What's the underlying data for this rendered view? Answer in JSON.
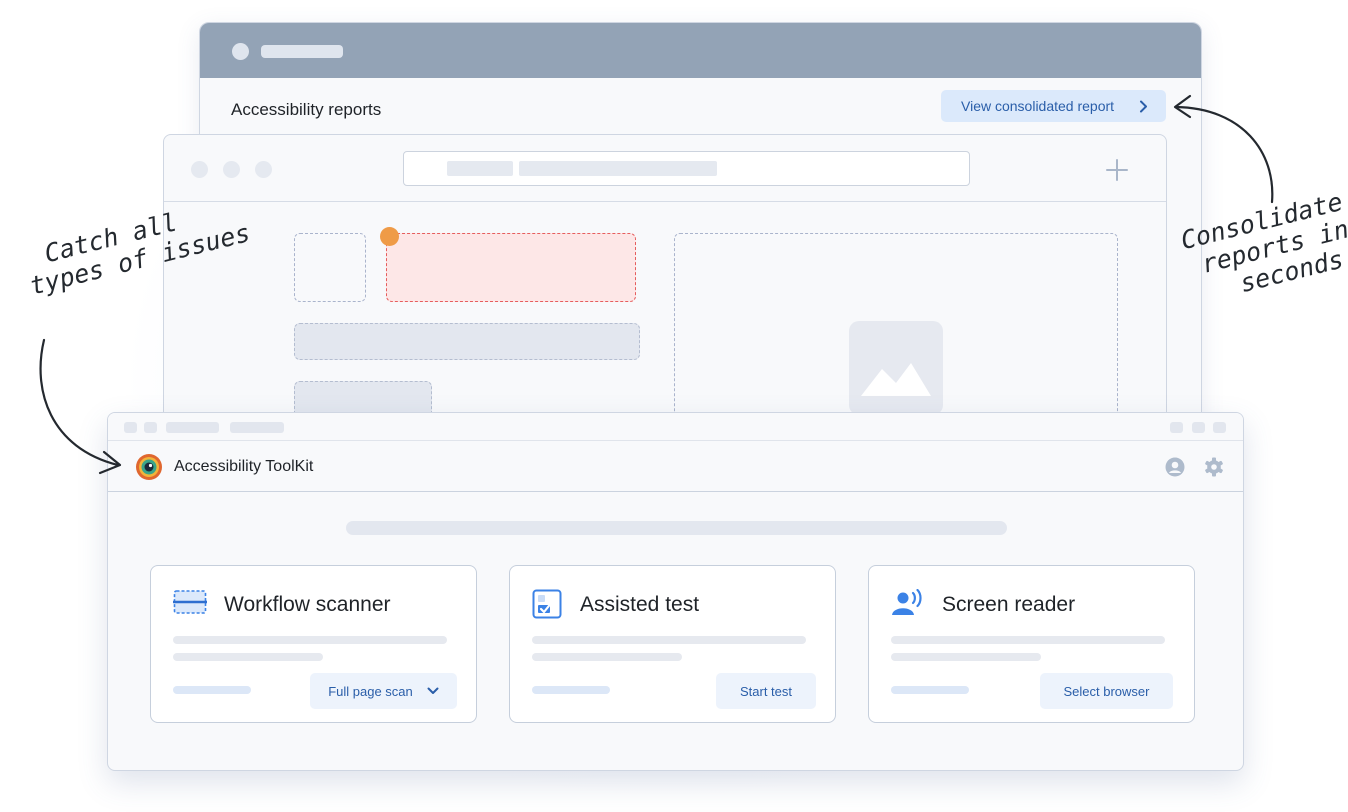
{
  "back_window": {
    "title": "Accessibility reports",
    "consolidated_button": "View consolidated report"
  },
  "toolkit": {
    "app_title": "Accessibility ToolKit",
    "icons": [
      "account-icon",
      "settings-gear-icon"
    ],
    "cards": [
      {
        "title": "Workflow scanner",
        "icon": "scanner-icon",
        "button": "Full page scan",
        "button_icon": "chevron-down-icon"
      },
      {
        "title": "Assisted test",
        "icon": "checklist-icon",
        "button": "Start test"
      },
      {
        "title": "Screen reader",
        "icon": "speaking-person-icon",
        "button": "Select browser"
      }
    ]
  },
  "annotations": {
    "left": [
      "Catch all",
      "types of issues"
    ],
    "right": [
      "Consolidate",
      "reports in",
      "seconds"
    ]
  },
  "colors": {
    "accent": "#2a5ea9",
    "back_titlebar": "#93a3b6",
    "error_highlight": "#e65e5e",
    "error_dot": "#ef9b47"
  }
}
